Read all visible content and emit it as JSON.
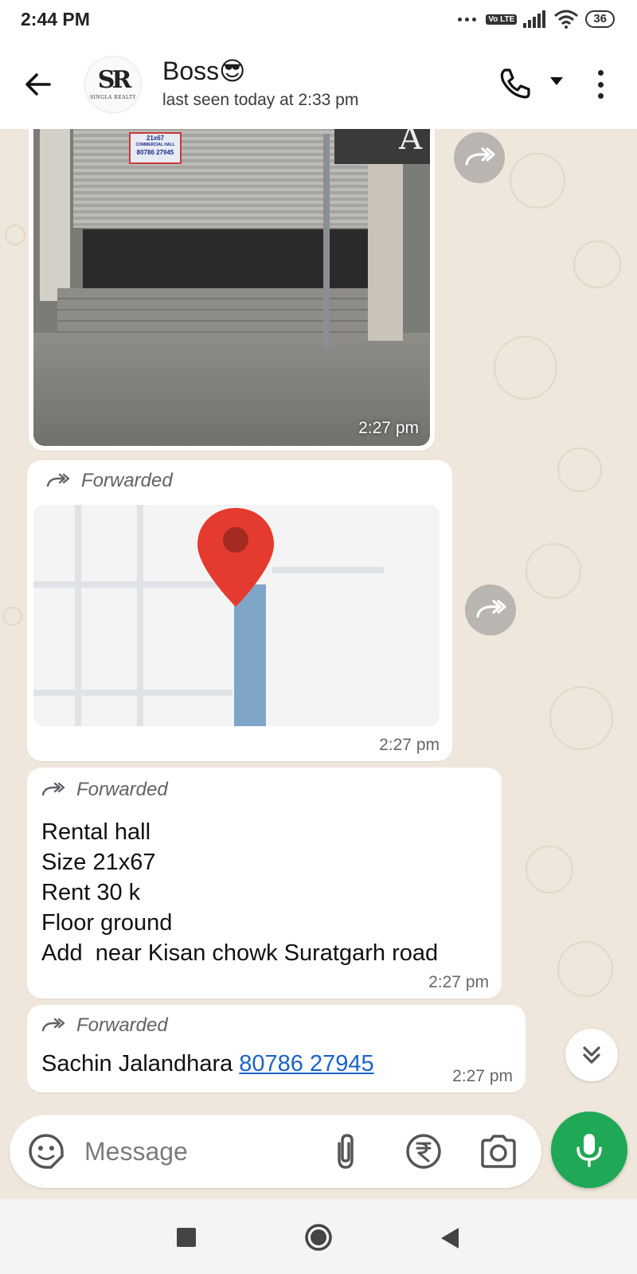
{
  "status_bar": {
    "time": "2:44 PM",
    "volte": "Vo LTE",
    "battery": "36"
  },
  "header": {
    "contact_name": "Boss😎",
    "last_seen": "last seen today at 2:33 pm",
    "avatar": {
      "monogram": "SR",
      "brand": "SINGLA REALTY"
    }
  },
  "messages": [
    {
      "type": "image",
      "time": "2:27 pm",
      "sign": {
        "size": "21x67",
        "text": "COMMERCIAL HALL",
        "phone": "80786 27945"
      },
      "board": "A"
    },
    {
      "type": "location",
      "forwarded_label": "Forwarded",
      "time": "2:27 pm"
    },
    {
      "type": "text",
      "forwarded_label": "Forwarded",
      "lines": [
        "Rental hall",
        "Size 21x67",
        "Rent 30 k",
        "Floor ground",
        "Add  near Kisan chowk Suratgarh road"
      ],
      "time": "2:27 pm"
    },
    {
      "type": "contact",
      "forwarded_label": "Forwarded",
      "name": "Sachin Jalandhara",
      "phone": "80786 27945",
      "time": "2:27 pm"
    }
  ],
  "composer": {
    "placeholder": "Message"
  },
  "colors": {
    "accent": "#1fa855",
    "link": "#1b62c8",
    "chat_bg": "#efe7dc"
  }
}
